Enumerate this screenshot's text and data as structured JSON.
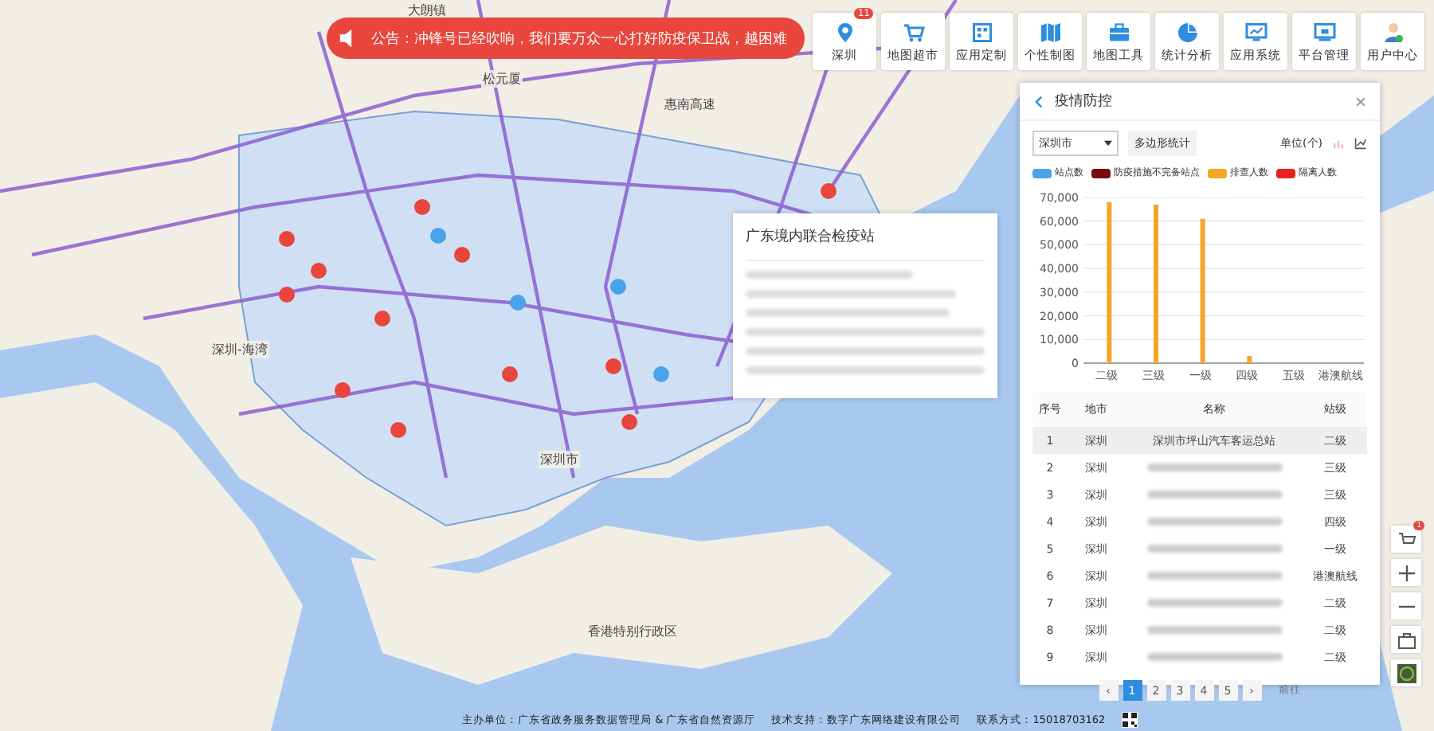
{
  "map": {
    "labels": [
      {
        "text": "大朗镇"
      },
      {
        "text": "松元厦"
      },
      {
        "text": "惠南高速"
      },
      {
        "text": "深圳市"
      },
      {
        "text": "香港特别行政区"
      },
      {
        "text": "深圳-海湾"
      }
    ]
  },
  "notice": {
    "text": "公告：冲锋号已经吹响，我们要万众一心打好防疫保卫战，越困难"
  },
  "toolbar": [
    {
      "label": "深圳",
      "kind": "location",
      "badge": "11"
    },
    {
      "label": "地图超市",
      "kind": "cart"
    },
    {
      "label": "应用定制",
      "kind": "grid"
    },
    {
      "label": "个性制图",
      "kind": "map"
    },
    {
      "label": "地图工具",
      "kind": "toolbox"
    },
    {
      "label": "统计分析",
      "kind": "pie"
    },
    {
      "label": "应用系统",
      "kind": "monitor"
    },
    {
      "label": "平台管理",
      "kind": "screen"
    },
    {
      "label": "用户中心",
      "kind": "user"
    }
  ],
  "popup": {
    "title": "广东境内联合检疫站"
  },
  "panel": {
    "title": "疫情防控",
    "city_select": "深圳市",
    "polygon_button": "多边形统计",
    "unit": "单位(个)",
    "chart_data": {
      "type": "bar",
      "grid": true,
      "categories": [
        "二级",
        "三级",
        "一级",
        "四级",
        "五级",
        "港澳航线"
      ],
      "ylim": [
        0,
        70000
      ],
      "yticks": [
        0,
        {
          "value": 10000,
          "label": "10,000"
        },
        {
          "value": 20000,
          "label": "20,000"
        },
        {
          "value": 30000,
          "label": "30,000"
        },
        {
          "value": 40000,
          "label": "40,000"
        },
        {
          "value": 50000,
          "label": "50,000"
        },
        {
          "value": 60000,
          "label": "60,000"
        },
        {
          "value": 70000,
          "label": "70,000"
        }
      ],
      "series": [
        {
          "name": "站点数",
          "color": "#4aa3e8",
          "values": [
            0,
            0,
            0,
            0,
            0,
            0
          ]
        },
        {
          "name": "防疫措施不完备站点",
          "color": "#7a0a0a",
          "values": [
            0,
            0,
            0,
            0,
            0,
            0
          ]
        },
        {
          "name": "排查人数",
          "color": "#f5a623",
          "values": [
            68000,
            67000,
            61000,
            3000,
            0,
            0
          ]
        },
        {
          "name": "隔离人数",
          "color": "#e8231f",
          "values": [
            0,
            0,
            0,
            0,
            0,
            0
          ]
        }
      ]
    },
    "columns": [
      "序号",
      "地市",
      "名称",
      "站级"
    ],
    "rows": [
      {
        "no": "1",
        "city": "深圳",
        "name": "深圳市坪山汽车客运总站",
        "level": "二级",
        "selected": true
      },
      {
        "no": "2",
        "city": "深圳",
        "level": "三级",
        "selected": false
      },
      {
        "no": "3",
        "city": "深圳",
        "level": "三级",
        "selected": false
      },
      {
        "no": "4",
        "city": "深圳",
        "level": "四级",
        "selected": false
      },
      {
        "no": "5",
        "city": "深圳",
        "level": "一级",
        "selected": false
      },
      {
        "no": "6",
        "city": "深圳",
        "level": "港澳航线",
        "selected": false
      },
      {
        "no": "7",
        "city": "深圳",
        "level": "二级",
        "selected": false
      },
      {
        "no": "8",
        "city": "深圳",
        "level": "二级",
        "selected": false
      },
      {
        "no": "9",
        "city": "深圳",
        "level": "二级",
        "selected": false
      }
    ],
    "pager": {
      "prev": "‹",
      "next": "›",
      "pages": [
        {
          "label": "1",
          "selected": true
        },
        {
          "label": "2",
          "selected": false
        },
        {
          "label": "3",
          "selected": false
        },
        {
          "label": "4",
          "selected": false
        },
        {
          "label": "5",
          "selected": false
        }
      ],
      "goto": "前往"
    }
  },
  "side_tools": [
    {
      "kind": "cart",
      "badge": "1"
    },
    {
      "kind": "plus"
    },
    {
      "kind": "minus"
    },
    {
      "kind": "toolbox"
    },
    {
      "kind": "globe"
    }
  ],
  "footer": {
    "sponsor": "主办单位：广东省政务服务数据管理局 & 广东省自然资源厅",
    "support": "技术支持：数字广东网络建设有限公司",
    "contact": "联系方式：15018703162"
  }
}
